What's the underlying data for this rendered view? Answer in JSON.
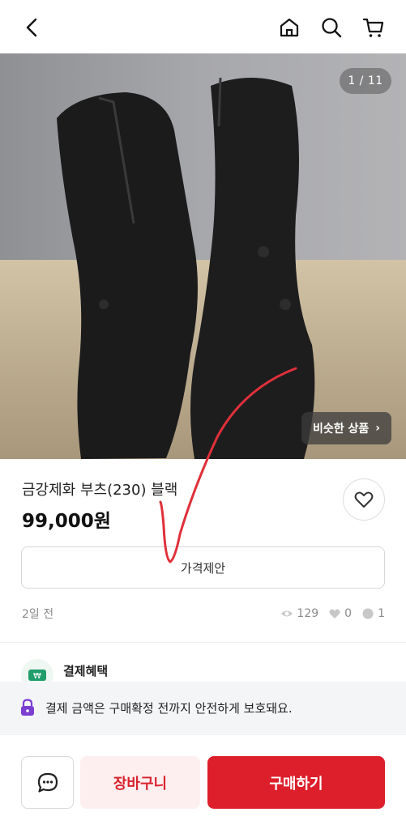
{
  "header": {
    "back_icon": "chevron-left-icon",
    "home_icon": "home-icon",
    "search_icon": "search-icon",
    "cart_icon": "cart-icon"
  },
  "gallery": {
    "counter": "1 / 11",
    "similar_label": "비슷한 상품",
    "similar_chevron": "›"
  },
  "product": {
    "title": "금강제화 부츠(230) 블랙",
    "price": "99,000원",
    "offer_label": "가격제안",
    "posted": "2일 전",
    "views": "129",
    "likes": "0",
    "chats": "1"
  },
  "benefit": {
    "label": "결제혜택",
    "icon": "won-icon"
  },
  "notice": {
    "text": "결제 금액은 구매확정 전까지 안전하게 보호돼요.",
    "icon": "lock-icon"
  },
  "actions": {
    "cart_label": "장바구니",
    "buy_label": "구매하기",
    "chat_icon": "chat-icon"
  },
  "colors": {
    "accent": "#dd1f2c",
    "accent_light": "#fdeef0",
    "benefit_green": "#1f9d6b",
    "lock_purple": "#7b3fd0"
  }
}
